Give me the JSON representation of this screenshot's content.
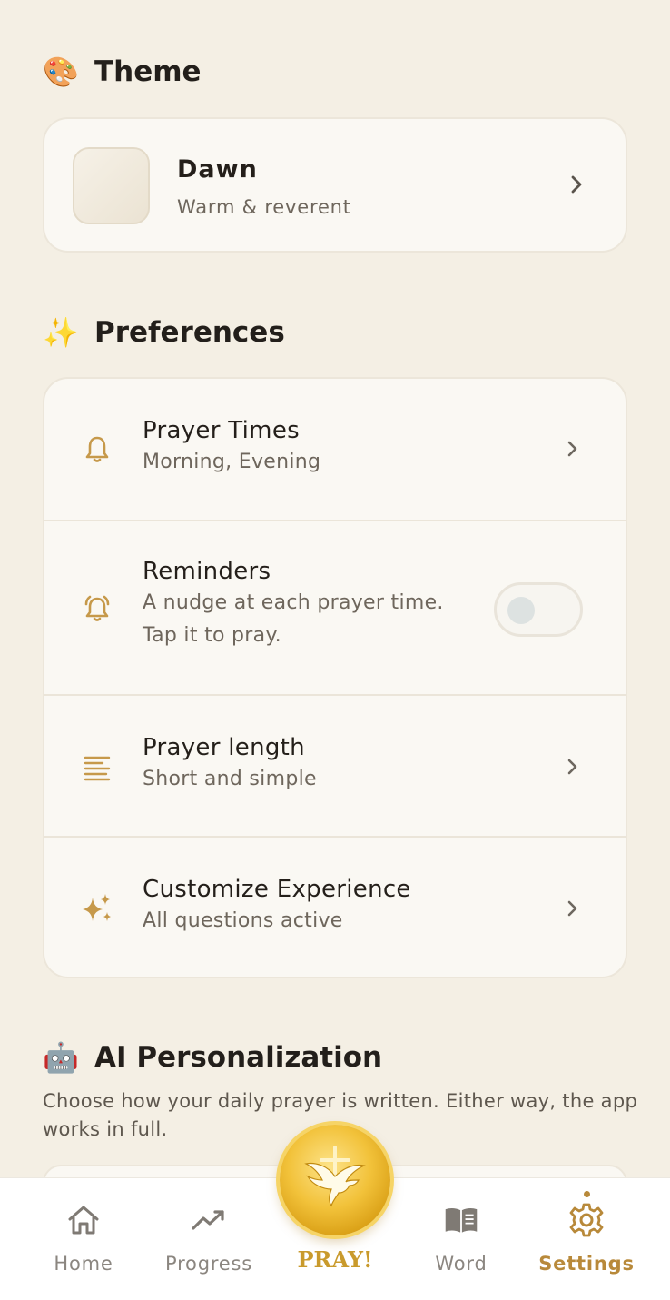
{
  "sections": {
    "theme": {
      "emoji": "🎨",
      "title": "Theme"
    },
    "preferences": {
      "emoji": "✨",
      "title": "Preferences"
    },
    "ai": {
      "emoji": "🤖",
      "title": "AI Personalization",
      "description": "Choose how your daily prayer is written. Either way, the app works in full."
    }
  },
  "theme_card": {
    "name": "Dawn",
    "subtitle": "Warm & reverent",
    "swatch_color": "#f1ebe0"
  },
  "preferences": [
    {
      "icon": "bell-icon",
      "title": "Prayer Times",
      "subtitle": "Morning, Evening",
      "control": "chevron"
    },
    {
      "icon": "alarm-icon",
      "title": "Reminders",
      "subtitle_line1": "A nudge at each prayer time.",
      "subtitle_line2": "Tap it to pray.",
      "control": "toggle",
      "toggle_on": false
    },
    {
      "icon": "text-lines-icon",
      "title": "Prayer length",
      "subtitle": "Short and simple",
      "control": "chevron"
    },
    {
      "icon": "sparkles-icon",
      "title": "Customize Experience",
      "subtitle": "All questions active",
      "control": "chevron"
    }
  ],
  "nav": {
    "home": "Home",
    "progress": "Progress",
    "pray": "PRAY!",
    "word": "Word",
    "settings": "Settings",
    "active": "settings"
  },
  "colors": {
    "background": "#f4efe4",
    "accent": "#c6994a",
    "active_nav": "#b8893a",
    "gold": "#f2c23a"
  }
}
